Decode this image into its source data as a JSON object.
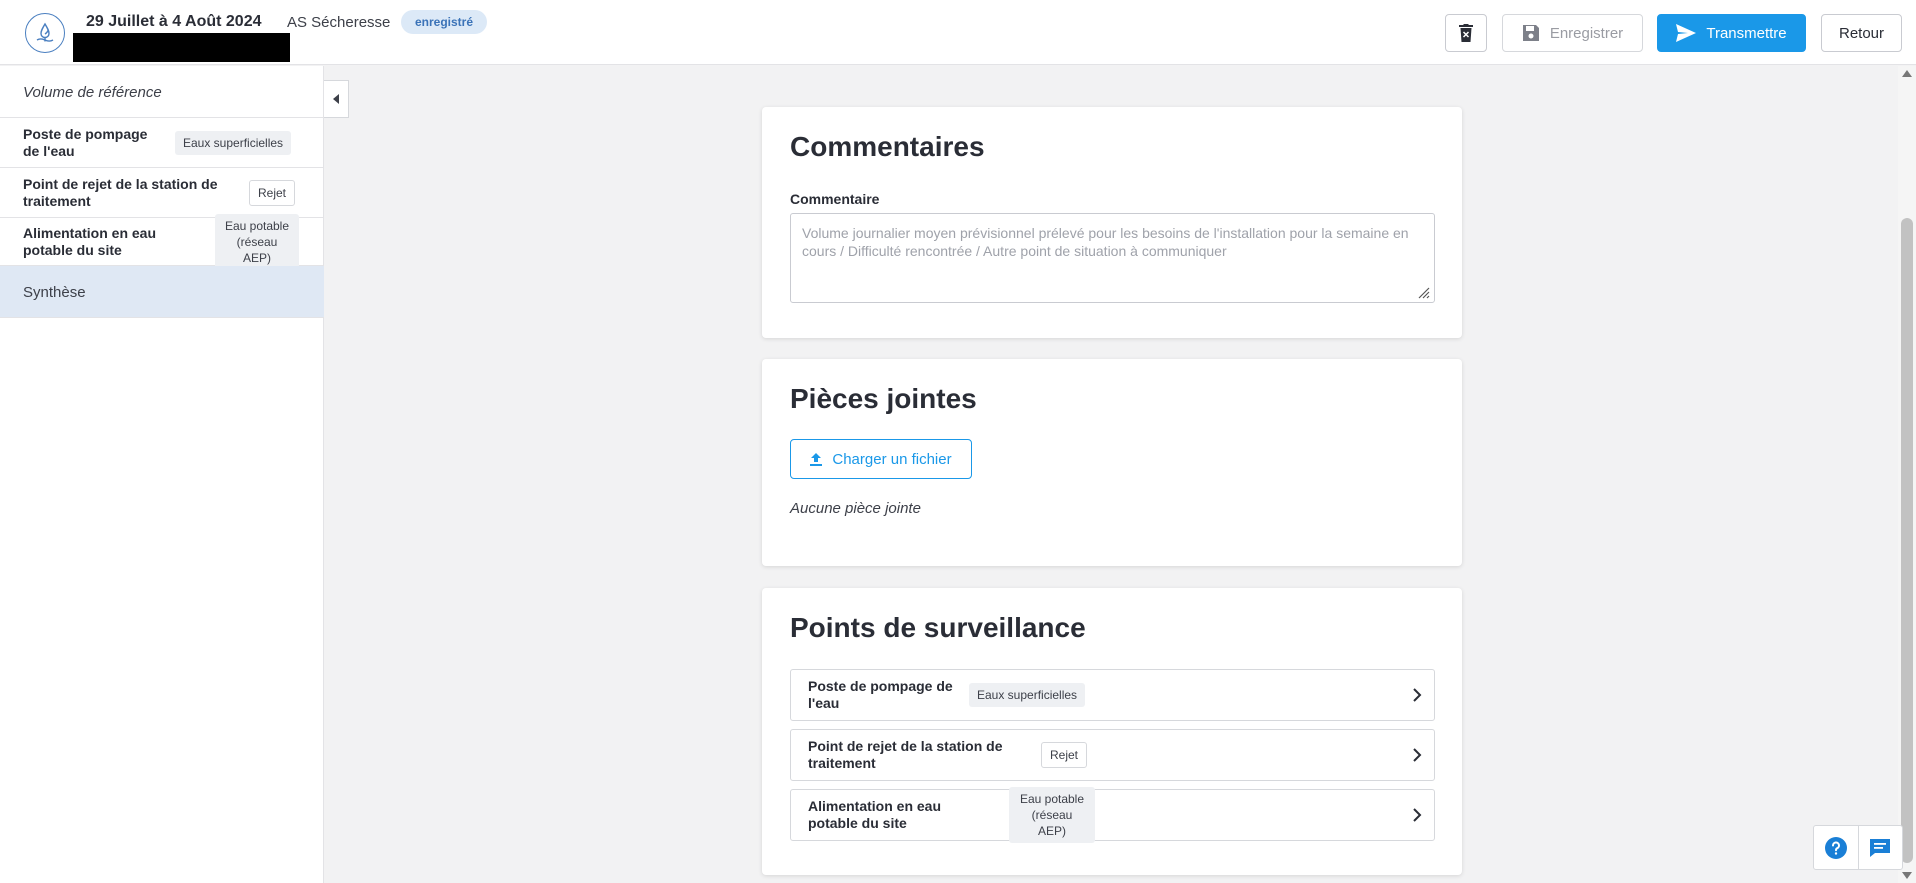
{
  "header": {
    "period": "29 Juillet à 4 Août 2024",
    "type": "AS Sécheresse",
    "status_badge": "enregistré",
    "delete_label": "",
    "save_label": "Enregistrer",
    "send_label": "Transmettre",
    "back_label": "Retour"
  },
  "sidebar": {
    "reference": "Volume de référence",
    "items": [
      {
        "label": "Poste de pompage de l'eau",
        "tag": "Eaux superficielles"
      },
      {
        "label": "Point de rejet de la station de traitement",
        "tag": "Rejet"
      },
      {
        "label": "Alimentation en eau potable du site",
        "tag": "Eau potable (réseau AEP)"
      }
    ],
    "synthesis": "Synthèse"
  },
  "comments": {
    "title": "Commentaires",
    "field_label": "Commentaire",
    "placeholder": "Volume journalier moyen prévisionnel prélevé pour les besoins de l'installation pour la semaine en cours / Difficulté rencontrée / Autre point de situation à communiquer"
  },
  "attachments": {
    "title": "Pièces jointes",
    "upload_label": "Charger un fichier",
    "empty_text": "Aucune pièce jointe"
  },
  "surveillance": {
    "title": "Points de surveillance",
    "points": [
      {
        "label": "Poste de pompage de l'eau",
        "tag": "Eaux superficielles"
      },
      {
        "label": "Point de rejet de la station de traitement",
        "tag": "Rejet"
      },
      {
        "label": "Alimentation en eau potable du site",
        "tag": "Eau potable (réseau AEP)"
      }
    ]
  },
  "colors": {
    "primary": "#1a98e8",
    "badge_bg": "#dce9f7",
    "badge_text": "#3b73b8",
    "selected_bg": "#dfe8f4"
  }
}
